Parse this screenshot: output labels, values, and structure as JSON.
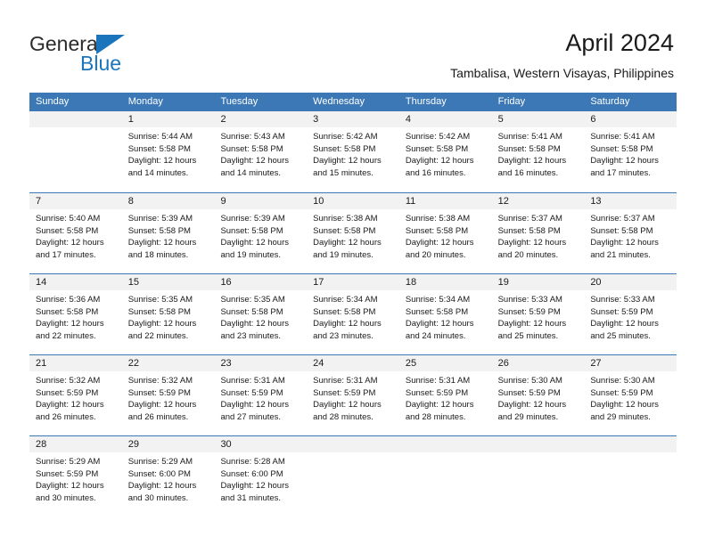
{
  "brand": {
    "name_part1": "General",
    "name_part2": "Blue",
    "accent_color": "#1b75bc"
  },
  "header": {
    "month_title": "April 2024",
    "location": "Tambalisa, Western Visayas, Philippines"
  },
  "calendar": {
    "header_bg": "#3b78b5",
    "day_band_bg": "#f2f2f2",
    "weekdays": [
      "Sunday",
      "Monday",
      "Tuesday",
      "Wednesday",
      "Thursday",
      "Friday",
      "Saturday"
    ],
    "weeks": [
      [
        {
          "day": "",
          "sunrise": "",
          "sunset": "",
          "daylight_line1": "",
          "daylight_line2": "",
          "empty": true
        },
        {
          "day": "1",
          "sunrise": "Sunrise: 5:44 AM",
          "sunset": "Sunset: 5:58 PM",
          "daylight_line1": "Daylight: 12 hours",
          "daylight_line2": "and 14 minutes."
        },
        {
          "day": "2",
          "sunrise": "Sunrise: 5:43 AM",
          "sunset": "Sunset: 5:58 PM",
          "daylight_line1": "Daylight: 12 hours",
          "daylight_line2": "and 14 minutes."
        },
        {
          "day": "3",
          "sunrise": "Sunrise: 5:42 AM",
          "sunset": "Sunset: 5:58 PM",
          "daylight_line1": "Daylight: 12 hours",
          "daylight_line2": "and 15 minutes."
        },
        {
          "day": "4",
          "sunrise": "Sunrise: 5:42 AM",
          "sunset": "Sunset: 5:58 PM",
          "daylight_line1": "Daylight: 12 hours",
          "daylight_line2": "and 16 minutes."
        },
        {
          "day": "5",
          "sunrise": "Sunrise: 5:41 AM",
          "sunset": "Sunset: 5:58 PM",
          "daylight_line1": "Daylight: 12 hours",
          "daylight_line2": "and 16 minutes."
        },
        {
          "day": "6",
          "sunrise": "Sunrise: 5:41 AM",
          "sunset": "Sunset: 5:58 PM",
          "daylight_line1": "Daylight: 12 hours",
          "daylight_line2": "and 17 minutes."
        }
      ],
      [
        {
          "day": "7",
          "sunrise": "Sunrise: 5:40 AM",
          "sunset": "Sunset: 5:58 PM",
          "daylight_line1": "Daylight: 12 hours",
          "daylight_line2": "and 17 minutes."
        },
        {
          "day": "8",
          "sunrise": "Sunrise: 5:39 AM",
          "sunset": "Sunset: 5:58 PM",
          "daylight_line1": "Daylight: 12 hours",
          "daylight_line2": "and 18 minutes."
        },
        {
          "day": "9",
          "sunrise": "Sunrise: 5:39 AM",
          "sunset": "Sunset: 5:58 PM",
          "daylight_line1": "Daylight: 12 hours",
          "daylight_line2": "and 19 minutes."
        },
        {
          "day": "10",
          "sunrise": "Sunrise: 5:38 AM",
          "sunset": "Sunset: 5:58 PM",
          "daylight_line1": "Daylight: 12 hours",
          "daylight_line2": "and 19 minutes."
        },
        {
          "day": "11",
          "sunrise": "Sunrise: 5:38 AM",
          "sunset": "Sunset: 5:58 PM",
          "daylight_line1": "Daylight: 12 hours",
          "daylight_line2": "and 20 minutes."
        },
        {
          "day": "12",
          "sunrise": "Sunrise: 5:37 AM",
          "sunset": "Sunset: 5:58 PM",
          "daylight_line1": "Daylight: 12 hours",
          "daylight_line2": "and 20 minutes."
        },
        {
          "day": "13",
          "sunrise": "Sunrise: 5:37 AM",
          "sunset": "Sunset: 5:58 PM",
          "daylight_line1": "Daylight: 12 hours",
          "daylight_line2": "and 21 minutes."
        }
      ],
      [
        {
          "day": "14",
          "sunrise": "Sunrise: 5:36 AM",
          "sunset": "Sunset: 5:58 PM",
          "daylight_line1": "Daylight: 12 hours",
          "daylight_line2": "and 22 minutes."
        },
        {
          "day": "15",
          "sunrise": "Sunrise: 5:35 AM",
          "sunset": "Sunset: 5:58 PM",
          "daylight_line1": "Daylight: 12 hours",
          "daylight_line2": "and 22 minutes."
        },
        {
          "day": "16",
          "sunrise": "Sunrise: 5:35 AM",
          "sunset": "Sunset: 5:58 PM",
          "daylight_line1": "Daylight: 12 hours",
          "daylight_line2": "and 23 minutes."
        },
        {
          "day": "17",
          "sunrise": "Sunrise: 5:34 AM",
          "sunset": "Sunset: 5:58 PM",
          "daylight_line1": "Daylight: 12 hours",
          "daylight_line2": "and 23 minutes."
        },
        {
          "day": "18",
          "sunrise": "Sunrise: 5:34 AM",
          "sunset": "Sunset: 5:58 PM",
          "daylight_line1": "Daylight: 12 hours",
          "daylight_line2": "and 24 minutes."
        },
        {
          "day": "19",
          "sunrise": "Sunrise: 5:33 AM",
          "sunset": "Sunset: 5:59 PM",
          "daylight_line1": "Daylight: 12 hours",
          "daylight_line2": "and 25 minutes."
        },
        {
          "day": "20",
          "sunrise": "Sunrise: 5:33 AM",
          "sunset": "Sunset: 5:59 PM",
          "daylight_line1": "Daylight: 12 hours",
          "daylight_line2": "and 25 minutes."
        }
      ],
      [
        {
          "day": "21",
          "sunrise": "Sunrise: 5:32 AM",
          "sunset": "Sunset: 5:59 PM",
          "daylight_line1": "Daylight: 12 hours",
          "daylight_line2": "and 26 minutes."
        },
        {
          "day": "22",
          "sunrise": "Sunrise: 5:32 AM",
          "sunset": "Sunset: 5:59 PM",
          "daylight_line1": "Daylight: 12 hours",
          "daylight_line2": "and 26 minutes."
        },
        {
          "day": "23",
          "sunrise": "Sunrise: 5:31 AM",
          "sunset": "Sunset: 5:59 PM",
          "daylight_line1": "Daylight: 12 hours",
          "daylight_line2": "and 27 minutes."
        },
        {
          "day": "24",
          "sunrise": "Sunrise: 5:31 AM",
          "sunset": "Sunset: 5:59 PM",
          "daylight_line1": "Daylight: 12 hours",
          "daylight_line2": "and 28 minutes."
        },
        {
          "day": "25",
          "sunrise": "Sunrise: 5:31 AM",
          "sunset": "Sunset: 5:59 PM",
          "daylight_line1": "Daylight: 12 hours",
          "daylight_line2": "and 28 minutes."
        },
        {
          "day": "26",
          "sunrise": "Sunrise: 5:30 AM",
          "sunset": "Sunset: 5:59 PM",
          "daylight_line1": "Daylight: 12 hours",
          "daylight_line2": "and 29 minutes."
        },
        {
          "day": "27",
          "sunrise": "Sunrise: 5:30 AM",
          "sunset": "Sunset: 5:59 PM",
          "daylight_line1": "Daylight: 12 hours",
          "daylight_line2": "and 29 minutes."
        }
      ],
      [
        {
          "day": "28",
          "sunrise": "Sunrise: 5:29 AM",
          "sunset": "Sunset: 5:59 PM",
          "daylight_line1": "Daylight: 12 hours",
          "daylight_line2": "and 30 minutes."
        },
        {
          "day": "29",
          "sunrise": "Sunrise: 5:29 AM",
          "sunset": "Sunset: 6:00 PM",
          "daylight_line1": "Daylight: 12 hours",
          "daylight_line2": "and 30 minutes."
        },
        {
          "day": "30",
          "sunrise": "Sunrise: 5:28 AM",
          "sunset": "Sunset: 6:00 PM",
          "daylight_line1": "Daylight: 12 hours",
          "daylight_line2": "and 31 minutes."
        },
        {
          "day": "",
          "sunrise": "",
          "sunset": "",
          "daylight_line1": "",
          "daylight_line2": "",
          "empty": true
        },
        {
          "day": "",
          "sunrise": "",
          "sunset": "",
          "daylight_line1": "",
          "daylight_line2": "",
          "empty": true
        },
        {
          "day": "",
          "sunrise": "",
          "sunset": "",
          "daylight_line1": "",
          "daylight_line2": "",
          "empty": true
        },
        {
          "day": "",
          "sunrise": "",
          "sunset": "",
          "daylight_line1": "",
          "daylight_line2": "",
          "empty": true
        }
      ]
    ]
  }
}
